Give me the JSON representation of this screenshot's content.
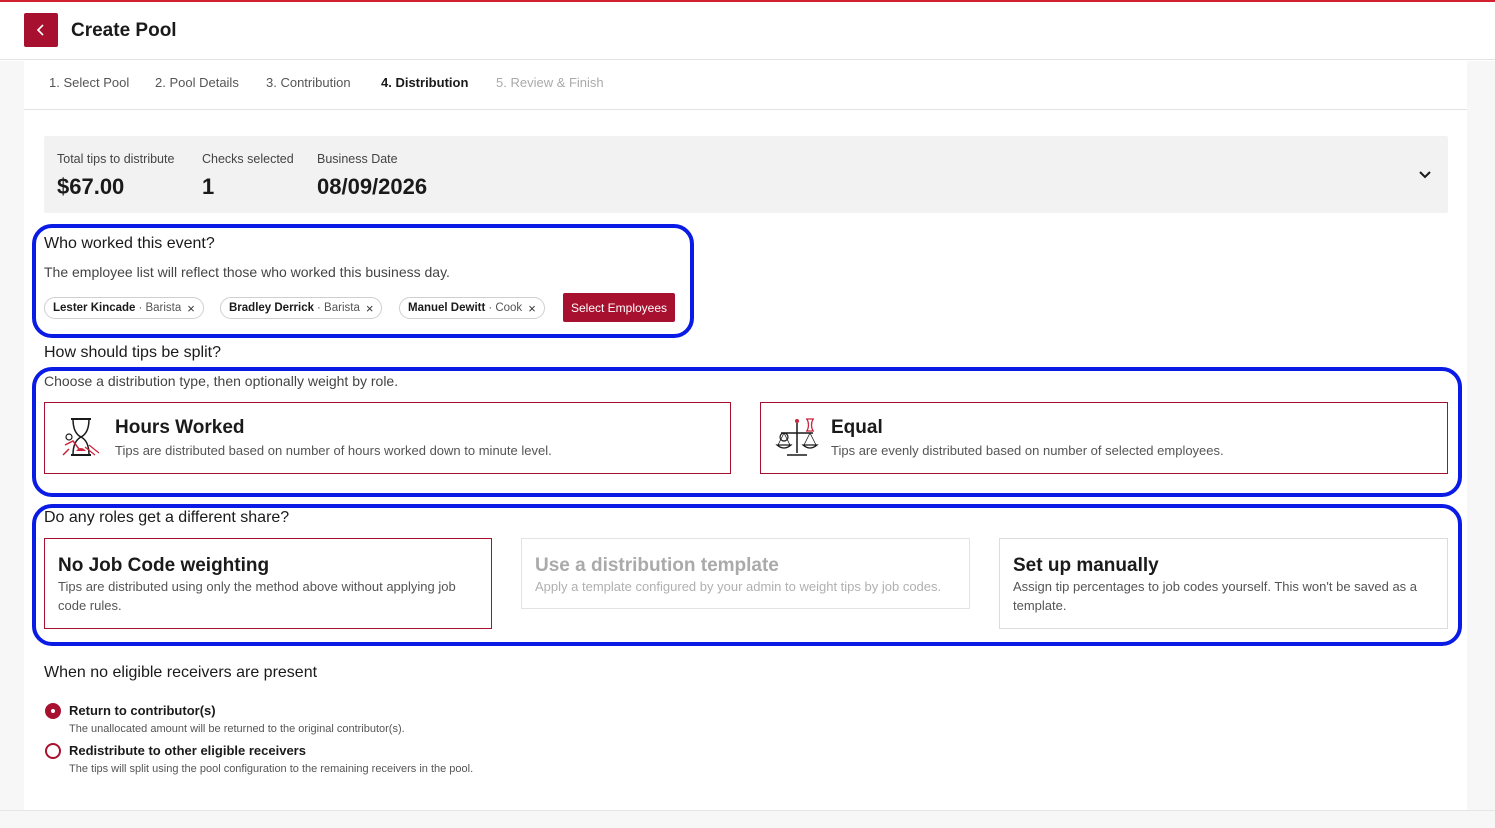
{
  "header": {
    "title": "Create Pool"
  },
  "steps": [
    {
      "label": "1. Select Pool"
    },
    {
      "label": "2. Pool Details"
    },
    {
      "label": "3. Contribution"
    },
    {
      "label": "4. Distribution"
    },
    {
      "label": "5. Review & Finish"
    }
  ],
  "summary": {
    "total_label": "Total tips to distribute",
    "total_value": "$67.00",
    "checks_label": "Checks selected",
    "checks_value": "1",
    "date_label": "Business Date",
    "date_value": "08/09/2026"
  },
  "who_worked": {
    "title": "Who worked this event?",
    "description": "The employee list will reflect those who worked this business day.",
    "employees": [
      {
        "name": "Lester Kincade",
        "role": "· Barista"
      },
      {
        "name": "Bradley Derrick",
        "role": "· Barista"
      },
      {
        "name": "Manuel Dewitt",
        "role": "· Cook"
      }
    ],
    "select_button": "Select Employees"
  },
  "split": {
    "title": "How should tips be split?",
    "description": "Choose a distribution type, then optionally weight by role.",
    "options": [
      {
        "title": "Hours Worked",
        "description": "Tips are distributed based on number of hours worked down to minute level.",
        "icon": "hourglass-person-icon"
      },
      {
        "title": "Equal",
        "description": "Tips are evenly distributed based on number of selected employees.",
        "icon": "balance-scale-icon"
      }
    ]
  },
  "roles": {
    "title": "Do any roles get a different share?",
    "options": [
      {
        "title": "No Job Code weighting",
        "description": "Tips are distributed using only the method above without applying job code rules."
      },
      {
        "title": "Use a distribution template",
        "description": "Apply a template configured by your admin to weight tips by job codes."
      },
      {
        "title": "Set up manually",
        "description": "Assign tip percentages to job codes yourself. This won't be saved as a template."
      }
    ]
  },
  "no_receivers": {
    "title": "When no eligible receivers are present",
    "options": [
      {
        "label": "Return to contributor(s)",
        "description": "The unallocated amount will be returned to the original contributor(s).",
        "checked": true
      },
      {
        "label": "Redistribute to other eligible receivers",
        "description": "The tips will split using the pool configuration to the remaining receivers in the pool.",
        "checked": false
      }
    ]
  },
  "colors": {
    "brand": "#a8102f",
    "highlight": "#0a1be6"
  }
}
